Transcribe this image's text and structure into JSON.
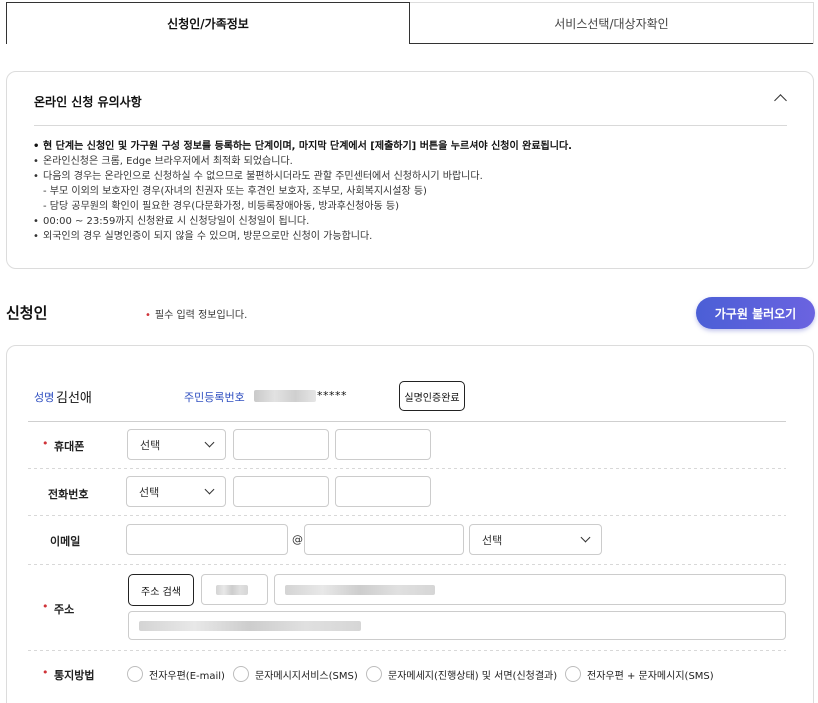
{
  "tabs": [
    {
      "label": "신청인/가족정보",
      "active": true
    },
    {
      "label": "서비스선택/대상자확인",
      "active": false
    }
  ],
  "notice": {
    "title": "온라인 신청 유의사항",
    "items": [
      "현 단계는 신청인 및 가구원 구성 정보를 등록하는 단계이며, 마지막 단계에서 [제출하기] 버튼을 누르셔야 신청이 완료됩니다.",
      "온라인신청은 크롬, Edge 브라우저에서 최적화 되었습니다.",
      "다음의 경우는 온라인으로 신청하실 수 없으므로 불편하시더라도 관할 주민센터에서 신청하시기 바랍니다.",
      "- 부모 이외의 보호자인 경우(자녀의 친권자 또는 후견인 보호자, 조부모, 사회복지시설장 등)",
      "- 담당 공무원의 확인이 필요한 경우(다문화가정, 비등록장애아동, 방과후신청아동 등)",
      "00:00 ~ 23:59까지 신청완료 시 신청당일이 신청일이 됩니다.",
      "외국인의 경우 실명인증이 되지 않을 수 있으며, 방문으로만 신청이 가능합니다."
    ]
  },
  "section": {
    "title": "신청인",
    "required_note": "필수 입력 정보입니다.",
    "required_mark": "•",
    "family_button": "가구원 불러오기"
  },
  "applicant": {
    "name_label": "성명",
    "name": "김선애",
    "rrn_label": "주민등록번호",
    "rrn_suffix": "*****",
    "verify_button": "실명인증완료"
  },
  "form": {
    "mobile": {
      "label": "휴대폰",
      "select": "선택"
    },
    "phone": {
      "label": "전화번호",
      "select": "선택"
    },
    "email": {
      "label": "이메일",
      "at": "@",
      "select": "선택"
    },
    "address": {
      "label": "주소",
      "search_button": "주소 검색"
    },
    "notify": {
      "label": "통지방법",
      "options": [
        "전자우편(E-mail)",
        "문자메시지서비스(SMS)",
        "문자메세지(진행상태) 및 서면(신청결과)",
        "전자우편 + 문자메시지(SMS)"
      ]
    }
  },
  "colors": {
    "accent": "#4b5fd6",
    "required": "#d0343a",
    "label_blue": "#2f4fc0"
  }
}
